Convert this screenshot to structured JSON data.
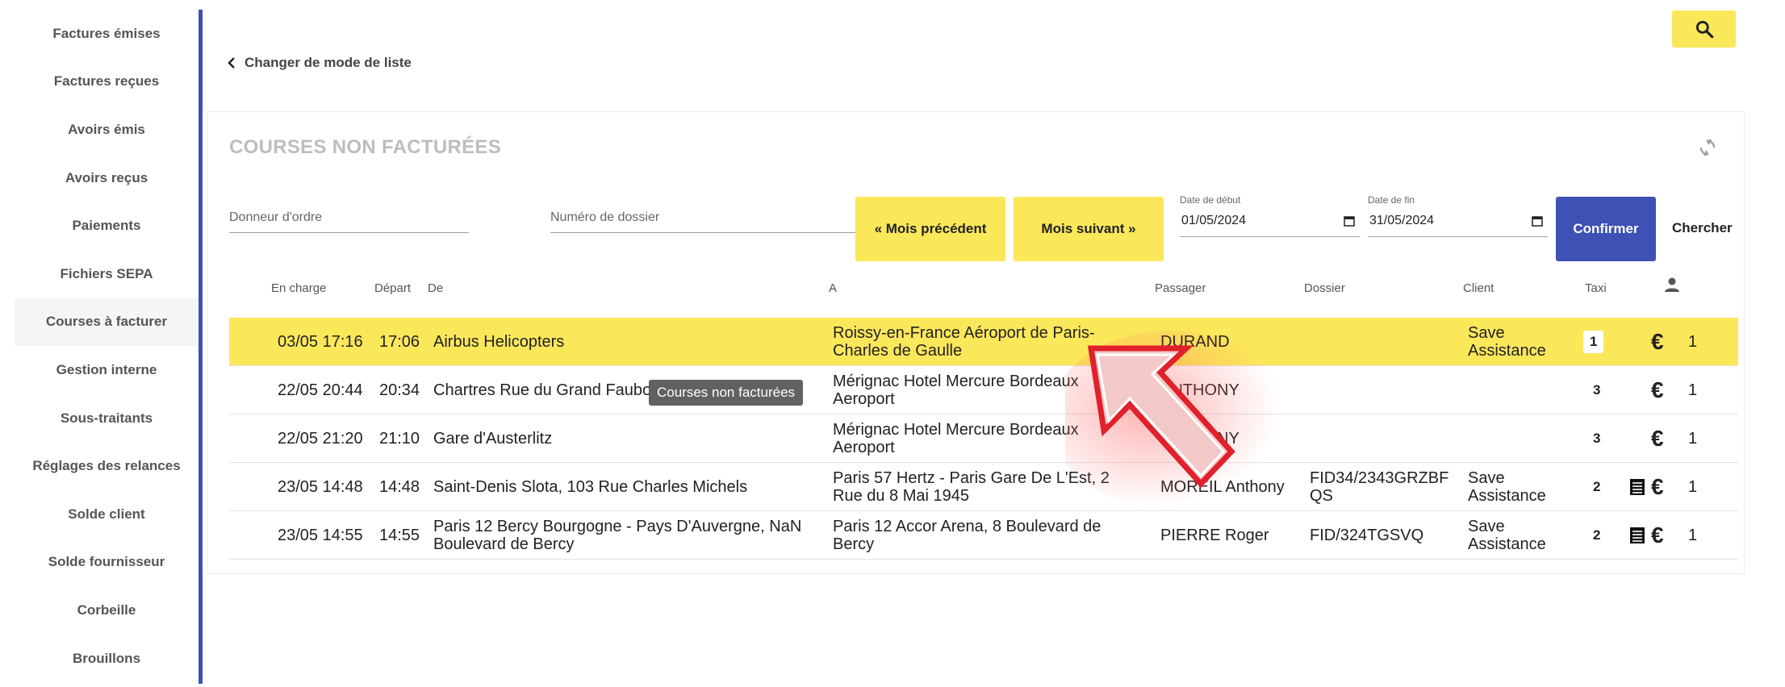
{
  "sidebar": {
    "items": [
      {
        "label": "Factures émises"
      },
      {
        "label": "Factures reçues"
      },
      {
        "label": "Avoirs émis"
      },
      {
        "label": "Avoirs reçus"
      },
      {
        "label": "Paiements"
      },
      {
        "label": "Fichiers SEPA"
      },
      {
        "label": "Courses à facturer",
        "active": true
      },
      {
        "label": "Gestion interne"
      },
      {
        "label": "Sous-traitants"
      },
      {
        "label": "Réglages des relances"
      },
      {
        "label": "Solde client"
      },
      {
        "label": "Solde fournisseur"
      },
      {
        "label": "Corbeille"
      },
      {
        "label": "Brouillons"
      }
    ]
  },
  "header": {
    "back_label": "Changer de mode de liste",
    "search_icon": "search-icon"
  },
  "card": {
    "title": "COURSES NON FACTURÉES",
    "filters": {
      "donneur_placeholder": "Donneur d'ordre",
      "dossier_placeholder": "Numéro de dossier",
      "prev_month_label": "« Mois précédent",
      "next_month_label": "Mois suivant »",
      "start_label": "Date de début",
      "start_value": "01/05/2024",
      "end_label": "Date de fin",
      "end_value": "31/05/2024",
      "confirm_label": "Confirmer",
      "search_label": "Chercher"
    },
    "columns": {
      "en_charge": "En charge",
      "depart": "Départ",
      "de": "De",
      "a": "A",
      "passager": "Passager",
      "dossier": "Dossier",
      "client": "Client",
      "taxi": "Taxi"
    },
    "rows": [
      {
        "en_charge": "03/05 17:16",
        "depart": "17:06",
        "de": "Airbus Helicopters",
        "a": "Roissy-en-France Aéroport de Paris-Charles de Gaulle",
        "passager": "DURAND",
        "dossier": "",
        "client": "Save Assistance",
        "taxi": "1",
        "count": "1",
        "has_doc": false
      },
      {
        "en_charge": "22/05 20:44",
        "depart": "20:34",
        "de": "Chartres Rue du Grand Faubo",
        "a": "Mérignac Hotel Mercure Bordeaux Aeroport",
        "passager": "ANTHONY",
        "dossier": "",
        "client": "",
        "taxi": "3",
        "count": "1",
        "has_doc": false
      },
      {
        "en_charge": "22/05 21:20",
        "depart": "21:10",
        "de": "Gare d'Austerlitz",
        "a": "Mérignac Hotel Mercure Bordeaux Aeroport",
        "passager": "ANTHONY",
        "dossier": "",
        "client": "",
        "taxi": "3",
        "count": "1",
        "has_doc": false
      },
      {
        "en_charge": "23/05 14:48",
        "depart": "14:48",
        "de": "Saint-Denis Slota, 103 Rue Charles Michels",
        "a": "Paris 57 Hertz - Paris Gare De L'Est, 2 Rue du 8 Mai 1945",
        "passager": "MOREIL Anthony",
        "dossier": "FID34/2343GRZBF QS",
        "client": "Save Assistance",
        "taxi": "2",
        "count": "1",
        "has_doc": true
      },
      {
        "en_charge": "23/05 14:55",
        "depart": "14:55",
        "de": "Paris 12 Bercy Bourgogne - Pays D'Auvergne, NaN Boulevard de Bercy",
        "a": "Paris 12 Accor Arena, 8 Boulevard de Bercy",
        "passager": "PIERRE Roger",
        "dossier": "FID/324TGSVQ",
        "client": "Save Assistance",
        "taxi": "2",
        "count": "1",
        "has_doc": true
      }
    ],
    "tooltip": "Courses non facturées"
  },
  "colors": {
    "accent_yellow": "#fbe75a",
    "accent_blue": "#3f51b5"
  }
}
